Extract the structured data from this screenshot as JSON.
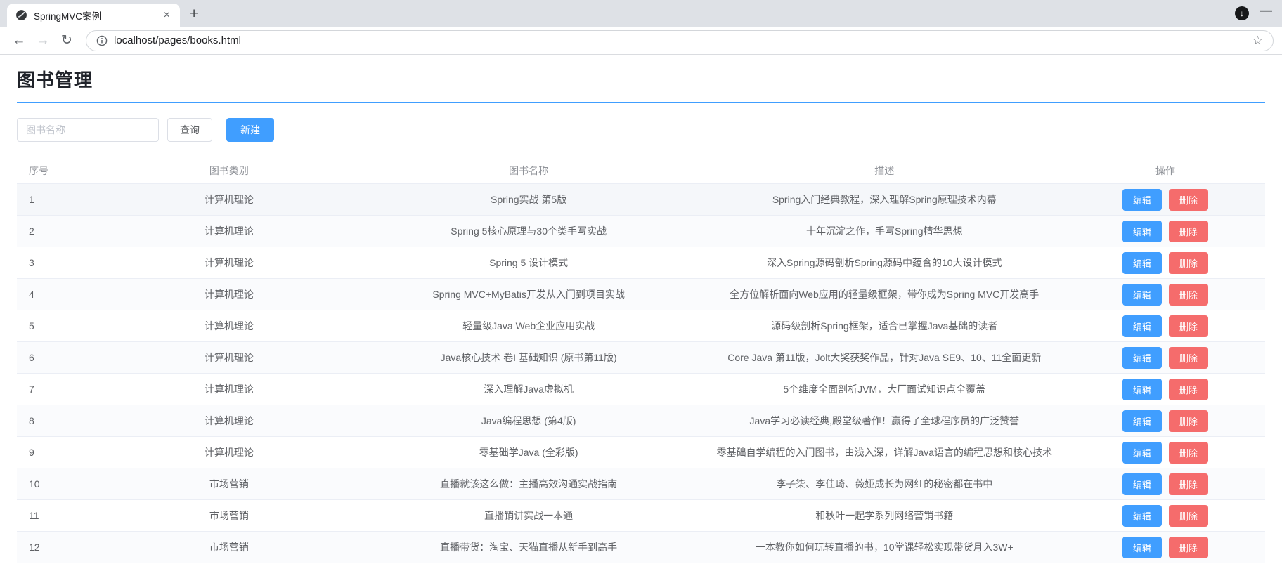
{
  "browser": {
    "tab_title": "SpringMVC案例",
    "url": "localhost/pages/books.html"
  },
  "colors": {
    "primary": "#409eff",
    "danger": "#f56c6c"
  },
  "page": {
    "title": "图书管理",
    "search_placeholder": "图书名称",
    "query_button": "查询",
    "create_button": "新建"
  },
  "table": {
    "headers": [
      "序号",
      "图书类别",
      "图书名称",
      "描述",
      "操作"
    ],
    "edit_label": "编辑",
    "delete_label": "删除",
    "rows": [
      {
        "index": "1",
        "category": "计算机理论",
        "name": "Spring实战 第5版",
        "description": "Spring入门经典教程，深入理解Spring原理技术内幕"
      },
      {
        "index": "2",
        "category": "计算机理论",
        "name": "Spring 5核心原理与30个类手写实战",
        "description": "十年沉淀之作，手写Spring精华思想"
      },
      {
        "index": "3",
        "category": "计算机理论",
        "name": "Spring 5 设计模式",
        "description": "深入Spring源码剖析Spring源码中蕴含的10大设计模式"
      },
      {
        "index": "4",
        "category": "计算机理论",
        "name": "Spring MVC+MyBatis开发从入门到项目实战",
        "description": "全方位解析面向Web应用的轻量级框架，带你成为Spring MVC开发高手"
      },
      {
        "index": "5",
        "category": "计算机理论",
        "name": "轻量级Java Web企业应用实战",
        "description": "源码级剖析Spring框架，适合已掌握Java基础的读者"
      },
      {
        "index": "6",
        "category": "计算机理论",
        "name": "Java核心技术 卷I 基础知识 (原书第11版)",
        "description": "Core Java 第11版，Jolt大奖获奖作品，针对Java SE9、10、11全面更新"
      },
      {
        "index": "7",
        "category": "计算机理论",
        "name": "深入理解Java虚拟机",
        "description": "5个维度全面剖析JVM，大厂面试知识点全覆盖"
      },
      {
        "index": "8",
        "category": "计算机理论",
        "name": "Java编程思想 (第4版)",
        "description": "Java学习必读经典,殿堂级著作！赢得了全球程序员的广泛赞誉"
      },
      {
        "index": "9",
        "category": "计算机理论",
        "name": "零基础学Java (全彩版)",
        "description": "零基础自学编程的入门图书，由浅入深，详解Java语言的编程思想和核心技术"
      },
      {
        "index": "10",
        "category": "市场营销",
        "name": "直播就该这么做：主播高效沟通实战指南",
        "description": "李子柒、李佳琦、薇娅成长为网红的秘密都在书中"
      },
      {
        "index": "11",
        "category": "市场营销",
        "name": "直播销讲实战一本通",
        "description": "和秋叶一起学系列网络营销书籍"
      },
      {
        "index": "12",
        "category": "市场营销",
        "name": "直播带货：淘宝、天猫直播从新手到高手",
        "description": "一本教你如何玩转直播的书，10堂课轻松实现带货月入3W+"
      }
    ]
  }
}
